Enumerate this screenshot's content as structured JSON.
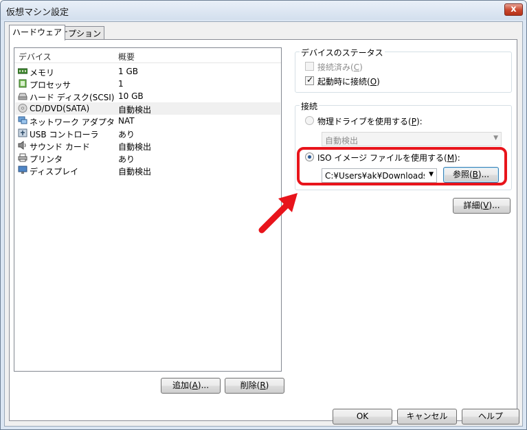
{
  "window": {
    "title": "仮想マシン設定",
    "close_glyph": "x"
  },
  "tabs": [
    {
      "label": "ハードウェア"
    },
    {
      "label": "オプション"
    }
  ],
  "device_list": {
    "headers": {
      "device": "デバイス",
      "summary": "概要"
    },
    "rows": [
      {
        "name": "メモリ",
        "summary": "1 GB",
        "icon": "memory-icon"
      },
      {
        "name": "プロセッサ",
        "summary": "1",
        "icon": "processor-icon"
      },
      {
        "name": "ハード ディスク(SCSI)",
        "summary": "10 GB",
        "icon": "hard-disk-icon"
      },
      {
        "name": "CD/DVD(SATA)",
        "summary": "自動検出",
        "icon": "cd-dvd-icon"
      },
      {
        "name": "ネットワーク アダプタ",
        "summary": "NAT",
        "icon": "network-adapter-icon"
      },
      {
        "name": "USB コントローラ",
        "summary": "あり",
        "icon": "usb-icon"
      },
      {
        "name": "サウンド カード",
        "summary": "自動検出",
        "icon": "sound-card-icon"
      },
      {
        "name": "プリンタ",
        "summary": "あり",
        "icon": "printer-icon"
      },
      {
        "name": "ディスプレイ",
        "summary": "自動検出",
        "icon": "display-icon"
      }
    ],
    "selected_row": "CD/DVD(SATA)"
  },
  "list_buttons": {
    "add": {
      "text": "追加(",
      "key": "A",
      "suffix": ")..."
    },
    "remove": {
      "text": "削除(",
      "key": "R",
      "suffix": ")"
    }
  },
  "device_status": {
    "label": "デバイスのステータス",
    "connected": {
      "text": "接続済み(",
      "key": "C",
      "suffix": ")",
      "checked": false,
      "enabled": false
    },
    "connect_at_power_on": {
      "text": "起動時に接続(",
      "key": "O",
      "suffix": ")",
      "checked": true,
      "enabled": true
    }
  },
  "connection": {
    "label": "接続",
    "physical_drive": {
      "text": "物理ドライブを使用する(",
      "key": "P",
      "suffix": "):",
      "selected": false,
      "combo_value": "自動検出"
    },
    "iso": {
      "text": "ISO イメージ ファイルを使用する(",
      "key": "M",
      "suffix": "):",
      "selected": true,
      "combo_value": "C:¥Users¥ak¥Downloads¥u"
    },
    "browse": {
      "text": "参照(",
      "key": "B",
      "suffix": ")..."
    }
  },
  "advanced": {
    "text": "詳細(",
    "key": "V",
    "suffix": ")..."
  },
  "footer": {
    "ok": "OK",
    "cancel": "キャンセル",
    "help": "ヘルプ"
  },
  "colors": {
    "highlight": "#e8141b",
    "arrow": "#e8141b"
  }
}
